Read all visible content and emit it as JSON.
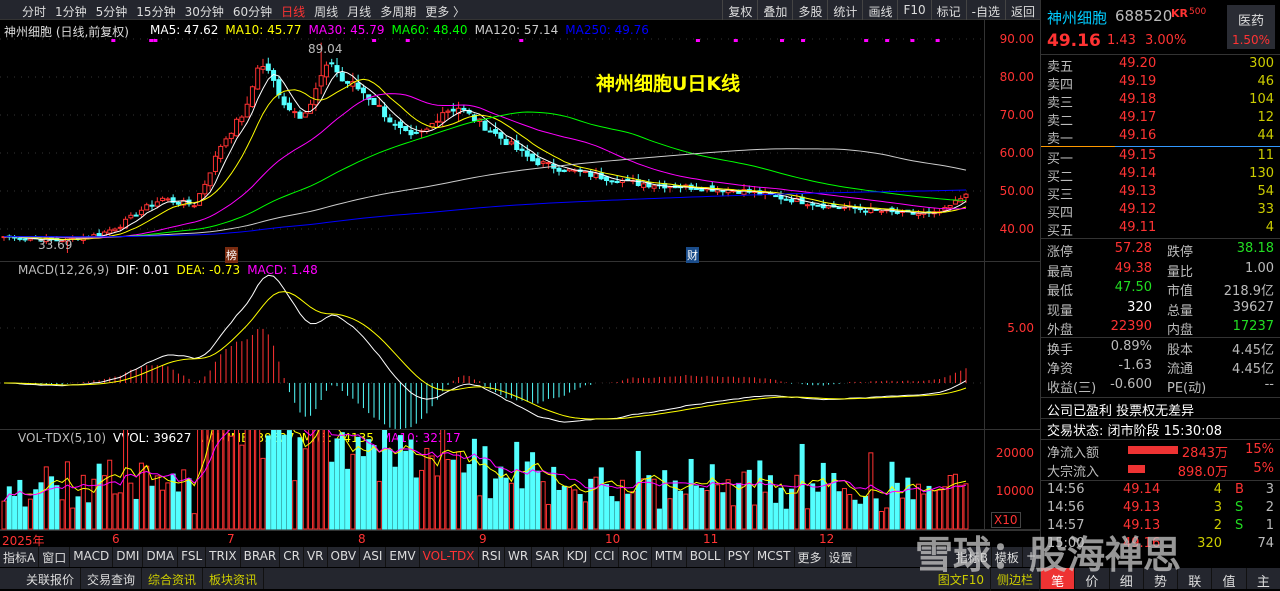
{
  "toolbar": {
    "periods": [
      "分时",
      "1分钟",
      "5分钟",
      "15分钟",
      "30分钟",
      "60分钟",
      "日线",
      "周线",
      "月线",
      "多周期",
      "更多 〉"
    ],
    "active_period": "日线",
    "tools": [
      "复权",
      "叠加",
      "多股",
      "统计",
      "画线",
      "F10",
      "标记",
      "-自选",
      "返回"
    ]
  },
  "price_panel": {
    "title": "神州细胞 (日线,前复权)",
    "ma": [
      {
        "label": "MA5: 47.62",
        "color": "#ffffff"
      },
      {
        "label": "MA10: 45.77",
        "color": "#ffff00"
      },
      {
        "label": "MA30: 45.79",
        "color": "#ff00ff"
      },
      {
        "label": "MA60: 48.40",
        "color": "#00ff00"
      },
      {
        "label": "MA120: 57.14",
        "color": "#cccccc"
      },
      {
        "label": "MA250: 49.76",
        "color": "#0000ff"
      }
    ],
    "annotation": "神州细胞U日K线",
    "high_label": "89.04",
    "low_label": "33.69",
    "marker_bang": "榜",
    "marker_cai": "财",
    "axis": [
      "90.00",
      "80.00",
      "70.00",
      "60.00",
      "50.00",
      "40.00"
    ]
  },
  "macd_panel": {
    "title": "MACD(12,26,9)",
    "dif": "DIF: 0.01",
    "dea": "DEA: -0.73",
    "macd": "MACD: 1.48",
    "axis": [
      "5.00"
    ]
  },
  "vol_panel": {
    "title": "VOL-TDX(5,10)",
    "vvol": "VVOL: 39627",
    "volume": "VOLUME: 39627",
    "ma5": "MA5: 44135",
    "ma10": "MA10: 32317",
    "axis": [
      "20000",
      "10000"
    ],
    "unit": "X10"
  },
  "dates": [
    "2025年",
    "6",
    "7",
    "8",
    "9",
    "10",
    "11",
    "12"
  ],
  "indicator_tabs": [
    "指标A",
    "窗口",
    "MACD",
    "DMI",
    "DMA",
    "FSL",
    "TRIX",
    "BRAR",
    "CR",
    "VR",
    "OBV",
    "ASI",
    "EMV",
    "VOL-TDX",
    "RSI",
    "WR",
    "SAR",
    "KDJ",
    "CCI",
    "ROC",
    "MTM",
    "BOLL",
    "PSY",
    "MCST",
    "更多",
    "设置"
  ],
  "active_indicator": "VOL-TDX",
  "indicator_right": [
    "指标B",
    "模板",
    "+"
  ],
  "bottom_tabs": [
    "关联报价",
    "交易查询",
    "综合资讯",
    "板块资讯"
  ],
  "bottom_right": [
    "图文F10",
    "侧边栏"
  ],
  "chart_data": {
    "type": "candlestick",
    "ylim": [
      30,
      95
    ],
    "close_keypoints": [
      [
        0,
        38
      ],
      [
        10,
        37
      ],
      [
        18,
        38.5
      ],
      [
        22,
        41
      ],
      [
        26,
        45
      ],
      [
        30,
        48
      ],
      [
        33,
        47
      ],
      [
        36,
        46.5
      ],
      [
        38,
        52
      ],
      [
        41,
        62
      ],
      [
        44,
        68
      ],
      [
        46,
        72
      ],
      [
        48,
        83
      ],
      [
        50,
        82
      ],
      [
        52,
        75
      ],
      [
        54,
        72
      ],
      [
        56,
        70
      ],
      [
        58,
        73
      ],
      [
        60,
        80
      ],
      [
        62,
        84
      ],
      [
        64,
        79
      ],
      [
        66,
        78
      ],
      [
        68,
        76
      ],
      [
        71,
        72
      ],
      [
        74,
        67
      ],
      [
        77,
        64
      ],
      [
        80,
        66
      ],
      [
        83,
        71
      ],
      [
        86,
        72
      ],
      [
        89,
        69
      ],
      [
        92,
        66
      ],
      [
        96,
        62
      ],
      [
        100,
        58
      ],
      [
        105,
        56
      ],
      [
        112,
        54
      ],
      [
        120,
        52
      ],
      [
        130,
        51
      ],
      [
        140,
        50
      ],
      [
        148,
        48
      ],
      [
        156,
        46
      ],
      [
        164,
        45
      ],
      [
        170,
        44
      ],
      [
        176,
        44
      ],
      [
        178,
        45
      ],
      [
        180,
        47
      ],
      [
        182,
        49.16
      ]
    ]
  },
  "quote": {
    "name": "神州细胞",
    "code": "688520",
    "tag": "KR",
    "tag2": "500",
    "sector": "医药",
    "sector_pct": "1.50%",
    "price": "49.16",
    "change": "1.43",
    "pct": "3.00%"
  },
  "orderbook": {
    "sell": [
      [
        "卖五",
        "49.20",
        "300"
      ],
      [
        "卖四",
        "49.19",
        "46"
      ],
      [
        "卖三",
        "49.18",
        "104"
      ],
      [
        "卖二",
        "49.17",
        "12"
      ],
      [
        "卖一",
        "49.16",
        "44"
      ]
    ],
    "buy": [
      [
        "买一",
        "49.15",
        "11"
      ],
      [
        "买二",
        "49.14",
        "130"
      ],
      [
        "买三",
        "49.13",
        "54"
      ],
      [
        "买四",
        "49.12",
        "33"
      ],
      [
        "买五",
        "49.11",
        "4"
      ]
    ]
  },
  "stats": [
    [
      "涨停",
      "57.28",
      "red",
      "跌停",
      "38.18",
      "green"
    ],
    [
      "最高",
      "49.38",
      "red",
      "量比",
      "1.00",
      "gry"
    ],
    [
      "最低",
      "47.50",
      "green",
      "市值",
      "218.9亿",
      "gry"
    ],
    [
      "现量",
      "320",
      "wht",
      "总量",
      "39627",
      "gry"
    ],
    [
      "外盘",
      "22390",
      "red",
      "内盘",
      "17237",
      "green"
    ]
  ],
  "stats2": [
    [
      "换手",
      "0.89%",
      "股本",
      "4.45亿"
    ],
    [
      "净资",
      "-1.63",
      "流通",
      "4.45亿"
    ],
    [
      "收益(三)",
      "-0.600",
      "PE(动)",
      "--"
    ]
  ],
  "notes": [
    "公司已盈利 投票权无差异",
    "交易状态: 闭市阶段 15:30:08"
  ],
  "flows": [
    {
      "label": "净流入额",
      "value": "2843万",
      "pct": "15%",
      "ratio": 0.15
    },
    {
      "label": "大宗流入",
      "value": "898.0万",
      "pct": "5%",
      "ratio": 0.05
    }
  ],
  "ticks": [
    [
      "14:56",
      "49.14",
      "4",
      "B",
      "3"
    ],
    [
      "14:56",
      "49.13",
      "3",
      "S",
      "2"
    ],
    [
      "14:57",
      "49.13",
      "2",
      "S",
      "1"
    ],
    [
      "15:00",
      "49.16",
      "320",
      "",
      "74"
    ]
  ],
  "side_tabs": [
    "笔",
    "价",
    "细",
    "势",
    "联",
    "值",
    "主"
  ],
  "watermark": "雪球：股海禅思"
}
